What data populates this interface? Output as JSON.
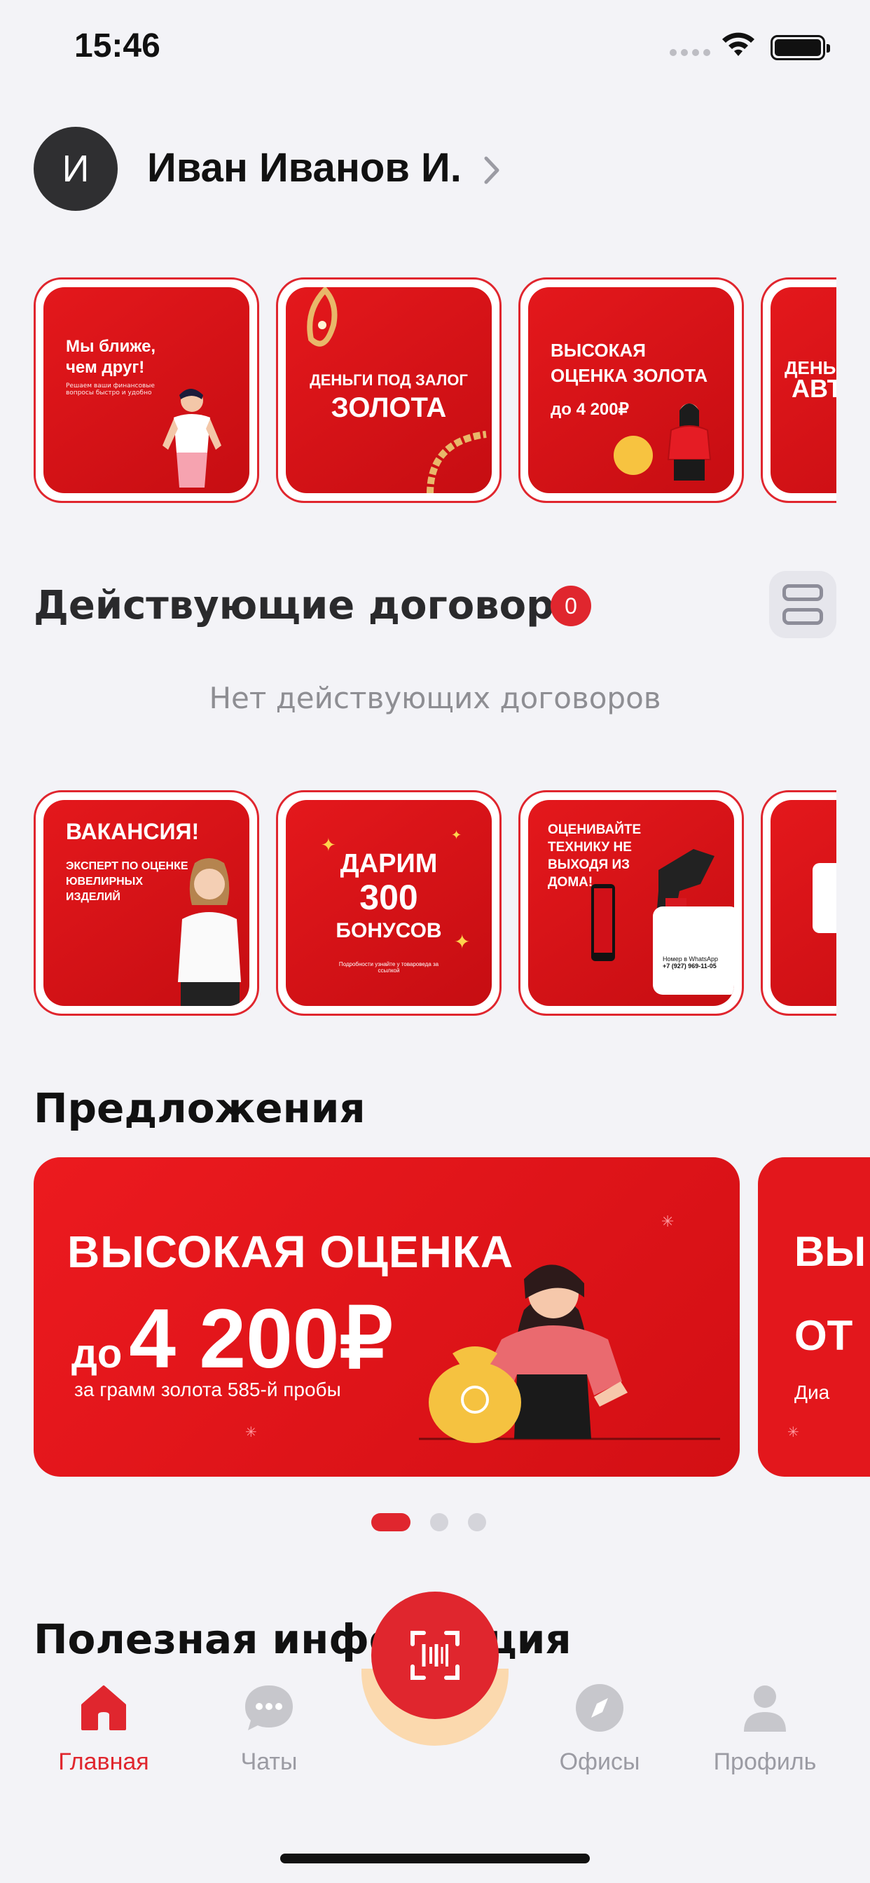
{
  "status_bar": {
    "time": "15:46"
  },
  "profile": {
    "initial": "И",
    "name": "Иван Иванов И."
  },
  "stories_top": [
    {
      "title": "Мы ближе, чем друг!",
      "subtitle": "Решаем ваши финансовые вопросы быстро и удобно"
    },
    {
      "title_small": "ДЕНЬГИ ПОД ЗАЛОГ",
      "title_big": "ЗОЛОТА"
    },
    {
      "title": "ВЫСОКАЯ ОЦЕНКА ЗОЛОТА",
      "price": "до 4 200₽"
    },
    {
      "title_small": "ДЕНЬГ",
      "title_big": "АВТО"
    }
  ],
  "contracts": {
    "title": "Действующие договоры",
    "count": "0",
    "empty_text": "Нет действующих договоров"
  },
  "stories_bottom": [
    {
      "title": "ВАКАНСИЯ!",
      "subtitle": "ЭКСПЕРТ ПО ОЦЕНКЕ ЮВЕЛИРНЫХ ИЗДЕЛИЙ"
    },
    {
      "line1": "ДАРИМ",
      "line2": "300",
      "line3": "БОНУСОВ",
      "footnote": "Подробности узнайте у товароведа за ссылкой"
    },
    {
      "title": "ОЦЕНИВАЙТЕ ТЕХНИКУ НЕ ВЫХОДЯ ИЗ ДОМА!",
      "whatsapp_label": "Номер в WhatsApp",
      "phone": "+7 (927) 969-11-05"
    },
    {
      "title": ""
    }
  ],
  "offers": {
    "title": "Предложения",
    "main": {
      "line1": "ВЫСОКАЯ ОЦЕНКА",
      "prefix": "до",
      "price": "4 200₽",
      "subtitle": "за грамм золота 585-й пробы"
    },
    "next_partial": {
      "line1": "ВЫ",
      "line2": "ОТ",
      "line3": "Диа"
    },
    "pager": {
      "count": 3,
      "active": 1
    }
  },
  "useful": {
    "title": "Полезная информация"
  },
  "tabbar": {
    "items": [
      {
        "label": "Главная",
        "icon": "home-icon",
        "active": true
      },
      {
        "label": "Чаты",
        "icon": "chat-icon",
        "active": false
      },
      {
        "label": "Офисы",
        "icon": "compass-icon",
        "active": false
      },
      {
        "label": "Профиль",
        "icon": "person-icon",
        "active": false
      }
    ],
    "scan_icon": "barcode-scan-icon"
  },
  "colors": {
    "accent": "#e0262e",
    "background": "#f3f3f7",
    "muted_text": "#8e8e93",
    "halo": "#fbd9ae"
  }
}
